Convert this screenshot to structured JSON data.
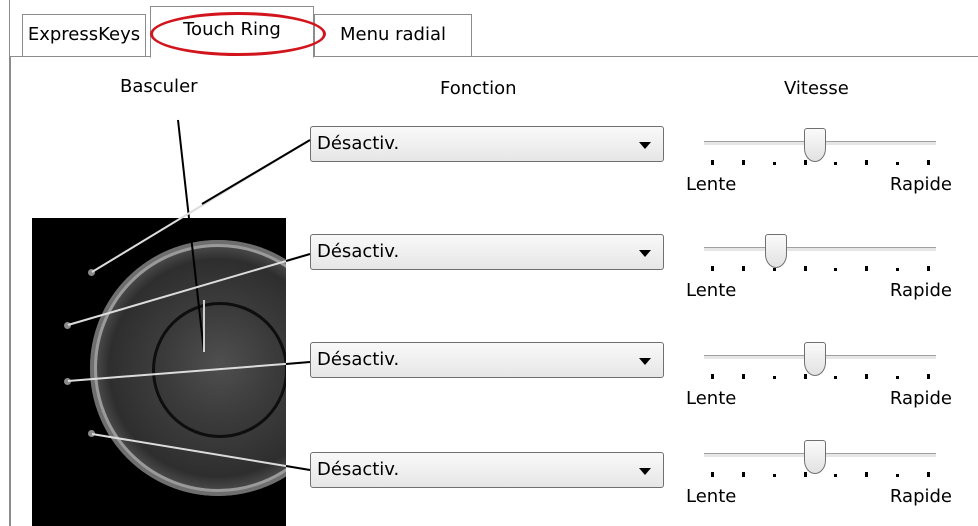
{
  "tabs": [
    {
      "label": "ExpressKeys",
      "active": false
    },
    {
      "label": "Touch Ring",
      "active": true
    },
    {
      "label": "Menu radial",
      "active": false
    }
  ],
  "headers": {
    "basculer": "Basculer",
    "fonction": "Fonction",
    "vitesse": "Vitesse"
  },
  "rows": [
    {
      "function": "Désactiv.",
      "speed_fraction": 0.48
    },
    {
      "function": "Désactiv.",
      "speed_fraction": 0.31
    },
    {
      "function": "Désactiv.",
      "speed_fraction": 0.48
    },
    {
      "function": "Désactiv.",
      "speed_fraction": 0.48
    }
  ],
  "speed_labels": {
    "min": "Lente",
    "max": "Rapide"
  },
  "colors": {
    "highlight_oval": "#d2141c",
    "ring_background": "#000000"
  },
  "icons": [
    "dropdown-arrow-icon",
    "slider-thumb-icon"
  ]
}
